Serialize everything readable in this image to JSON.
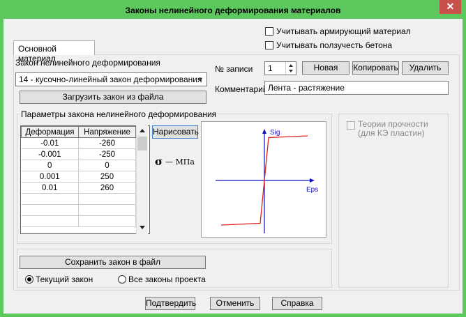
{
  "window": {
    "title": "Законы нелинейного деформирования материалов",
    "close_symbol": "✕"
  },
  "options": {
    "reinforcing_label": "Учитывать армирующий материал",
    "creep_label": "Учитывать ползучесть бетона"
  },
  "tabs": [
    {
      "label": "Основной материал"
    }
  ],
  "law": {
    "group_label": "Закон нелинейного деформирования",
    "selected": "14 - кусочно-линейный закон деформирования",
    "load_button": "Загрузить закон из файла"
  },
  "record": {
    "label": "№ записи",
    "value": "1",
    "new_button": "Новая",
    "copy_button": "Копировать",
    "delete_button": "Удалить",
    "comment_label": "Комментарий",
    "comment_value": "Лента - растяжение"
  },
  "params": {
    "group_label": "Параметры закона нелинейного деформирования",
    "table": {
      "headers": [
        "Деформация",
        "Напряжение"
      ],
      "rows": [
        [
          "-0.01",
          "-260"
        ],
        [
          "-0.001",
          "-250"
        ],
        [
          "0",
          "0"
        ],
        [
          "0.001",
          "250"
        ],
        [
          "0.01",
          "260"
        ],
        [
          "",
          ""
        ],
        [
          "",
          ""
        ],
        [
          "",
          ""
        ]
      ]
    },
    "draw_button": "Нарисовать",
    "sigma_symbol": "σ",
    "units": "— МПа"
  },
  "chart_data": {
    "type": "line",
    "x_axis_label": "Eps",
    "y_axis_label": "Sig",
    "x": [
      -0.01,
      -0.001,
      0,
      0.001,
      0.01
    ],
    "y": [
      -260,
      -250,
      0,
      250,
      260
    ],
    "line_color": "#e02020",
    "axis_color": "#1010c0"
  },
  "strength": {
    "label_line1": "Теории прочности",
    "label_line2": "(для КЭ пластин)"
  },
  "save": {
    "button": "Сохранить закон в файл",
    "radio_current": "Текущий закон",
    "radio_all": "Все законы проекта"
  },
  "footer": {
    "confirm": "Подтвердить",
    "cancel": "Отменить",
    "help": "Справка"
  }
}
